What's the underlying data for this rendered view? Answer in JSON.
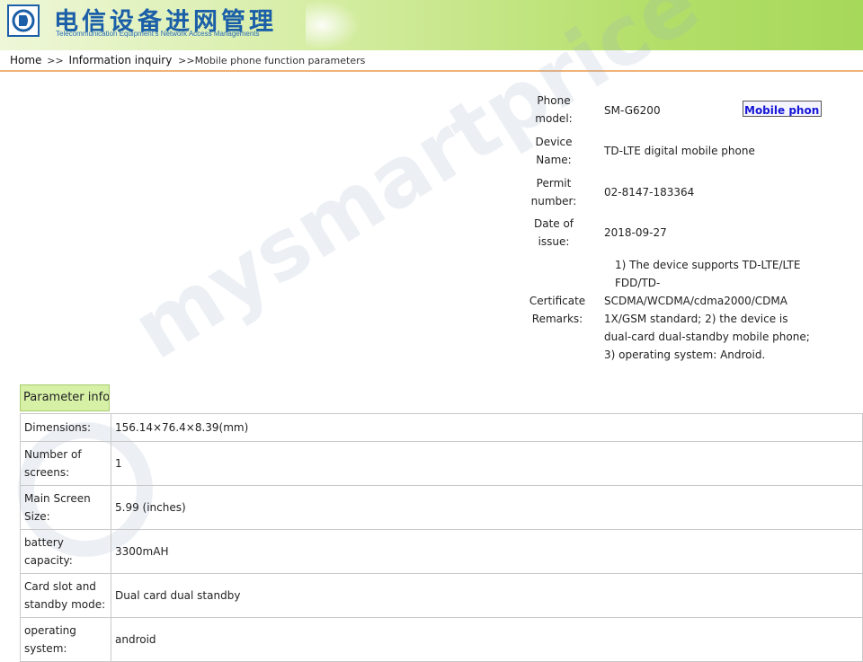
{
  "header": {
    "title_cn": "电信设备进网管理",
    "title_en": "Telecommunication Equipment's Network Access Managements",
    "logo_icon": "network-access-logo",
    "colors": {
      "brand_blue": "#1b5fa8",
      "banner_green": "#b4df6a"
    }
  },
  "breadcrumb": {
    "home": "Home",
    "sep1": ">>",
    "info": "Information inquiry",
    "current": ">>Mobile phone function parameters"
  },
  "phone": {
    "model_label_1": "Phone",
    "model_label_2": "model:",
    "model": "SM-G6200",
    "mobile_button": "Mobile phon",
    "device_label_1": "Device",
    "device_label_2": "Name:",
    "device": "TD-LTE digital mobile phone",
    "permit_label_1": "Permit",
    "permit_label_2": "number:",
    "permit": "02-8147-183364",
    "date_label_1": "Date of",
    "date_label_2": "issue:",
    "date": "2018-09-27",
    "remarks_label_1": "Certificate",
    "remarks_label_2": "Remarks:",
    "remarks_lines": [
      "1) The device supports TD-LTE/LTE",
      "FDD/TD-",
      "SCDMA/WCDMA/cdma2000/CDMA",
      "1X/GSM standard; 2) the device is",
      "dual-card dual-standby mobile phone;",
      "3) operating system: Android."
    ]
  },
  "params": {
    "heading": "Parameter info",
    "rows": [
      {
        "key_1": "Dimensions:",
        "key_2": "",
        "value": "156.14×76.4×8.39(mm)"
      },
      {
        "key_1": "Number of",
        "key_2": "screens:",
        "value": "1"
      },
      {
        "key_1": "Main Screen",
        "key_2": "Size:",
        "value": "5.99 (inches)"
      },
      {
        "key_1": "battery",
        "key_2": "capacity:",
        "value": "3300mAH"
      },
      {
        "key_1": "Card slot and",
        "key_2": "standby mode:",
        "value": "Dual card dual standby"
      },
      {
        "key_1": "operating",
        "key_2": "system:",
        "value": "android"
      }
    ]
  },
  "watermark": {
    "text": "mysmartprice"
  }
}
